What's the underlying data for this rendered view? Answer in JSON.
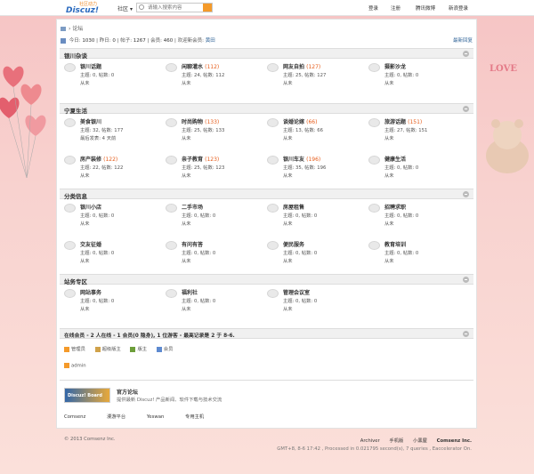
{
  "header": {
    "logo_text": "Discuz!",
    "logo_sub": "社区动力",
    "community_label": "社区",
    "search_placeholder": "请输入搜索内容",
    "links": [
      "登录",
      "注册",
      "腾讯微博",
      "新浪登录"
    ]
  },
  "breadcrumb": {
    "label": "论坛"
  },
  "stats": {
    "today_label": "今日:",
    "today": "1030",
    "yesterday_label": "昨日:",
    "yesterday": "0",
    "posts_label": "帖子:",
    "posts": "1267",
    "members_label": "会员:",
    "members": "460",
    "welcome_label": "欢迎新会员:",
    "new_member": "黄田",
    "latest_label": "最新回复"
  },
  "sections": [
    {
      "title": "银川杂谈",
      "forums": [
        {
          "name": "银川话题",
          "today": "",
          "meta": "主题: 0, 帖数: 0",
          "meta2": "从未"
        },
        {
          "name": "闲聊灌水",
          "today": "(112)",
          "meta": "主题: 24, 帖数: 112",
          "meta2": "从未"
        },
        {
          "name": "网友自拍",
          "today": "(127)",
          "meta": "主题: 25, 帖数: 127",
          "meta2": "从未"
        },
        {
          "name": "摄影沙龙",
          "today": "",
          "meta": "主题: 0, 帖数: 0",
          "meta2": "从未"
        }
      ]
    },
    {
      "title": "宁夏生活",
      "forums": [
        {
          "name": "美食银川",
          "today": "",
          "meta": "主题: 32, 帖数: 177",
          "meta2": "最后发表: 4 天前"
        },
        {
          "name": "时尚购物",
          "today": "(133)",
          "meta": "主题: 25, 帖数: 133",
          "meta2": "从未"
        },
        {
          "name": "谈婚论嫁",
          "today": "(66)",
          "meta": "主题: 13, 帖数: 66",
          "meta2": "从未"
        },
        {
          "name": "旅游话题",
          "today": "(151)",
          "meta": "主题: 27, 帖数: 151",
          "meta2": "从未"
        },
        {
          "name": "房产装修",
          "today": "(122)",
          "meta": "主题: 22, 帖数: 122",
          "meta2": "从未"
        },
        {
          "name": "亲子教育",
          "today": "(123)",
          "meta": "主题: 25, 帖数: 123",
          "meta2": "从未"
        },
        {
          "name": "银川车友",
          "today": "(196)",
          "meta": "主题: 35, 帖数: 196",
          "meta2": "从未"
        },
        {
          "name": "健康生活",
          "today": "",
          "meta": "主题: 0, 帖数: 0",
          "meta2": "从未"
        }
      ]
    },
    {
      "title": "分类信息",
      "forums": [
        {
          "name": "银川小店",
          "today": "",
          "meta": "主题: 0, 帖数: 0",
          "meta2": "从未"
        },
        {
          "name": "二手市场",
          "today": "",
          "meta": "主题: 0, 帖数: 0",
          "meta2": "从未"
        },
        {
          "name": "房屋租售",
          "today": "",
          "meta": "主题: 0, 帖数: 0",
          "meta2": "从未"
        },
        {
          "name": "招聘求职",
          "today": "",
          "meta": "主题: 0, 帖数: 0",
          "meta2": "从未"
        },
        {
          "name": "交友征婚",
          "today": "",
          "meta": "主题: 0, 帖数: 0",
          "meta2": "从未"
        },
        {
          "name": "有问有答",
          "today": "",
          "meta": "主题: 0, 帖数: 0",
          "meta2": "从未"
        },
        {
          "name": "便民服务",
          "today": "",
          "meta": "主题: 0, 帖数: 0",
          "meta2": "从未"
        },
        {
          "name": "教育培训",
          "today": "",
          "meta": "主题: 0, 帖数: 0",
          "meta2": "从未"
        }
      ]
    },
    {
      "title": "站务专区",
      "forums": [
        {
          "name": "网站事务",
          "today": "",
          "meta": "主题: 0, 帖数: 0",
          "meta2": "从未"
        },
        {
          "name": "福利社",
          "today": "",
          "meta": "主题: 0, 帖数: 0",
          "meta2": "从未"
        },
        {
          "name": "管理会议室",
          "today": "",
          "meta": "主题: 0, 帖数: 0",
          "meta2": "从未"
        }
      ]
    }
  ],
  "online": {
    "text": "在线会员 - 2 人在线 - 1 会员(0 隐身), 1 位游客 - 最高记录是 2 于 8-6.",
    "legend": [
      {
        "label": "管理员",
        "color": "#f49a2a"
      },
      {
        "label": "超级版主",
        "color": "#d0a24a"
      },
      {
        "label": "版主",
        "color": "#6d9e3a"
      },
      {
        "label": "会员",
        "color": "#5d8ad0"
      }
    ],
    "admin_user": "admin"
  },
  "links_box": {
    "badge_text": "Discuz! Board",
    "title": "官方论坛",
    "desc": "提供最新 Discuz! 产品新闻、软件下载与技术交流",
    "friend_links": [
      "Comsenz",
      "漫游平台",
      "Yeswan",
      "专用主机"
    ]
  },
  "footer": {
    "copyright": "© 2013 Comsenz Inc.",
    "links": [
      "Archiver",
      "手机版",
      "小黑屋"
    ],
    "brand": "Comsenz Inc.",
    "info": "GMT+8, 8-6 17:42 , Processed in 0.021795 second(s), 7 queries , Eaccelerator On."
  }
}
